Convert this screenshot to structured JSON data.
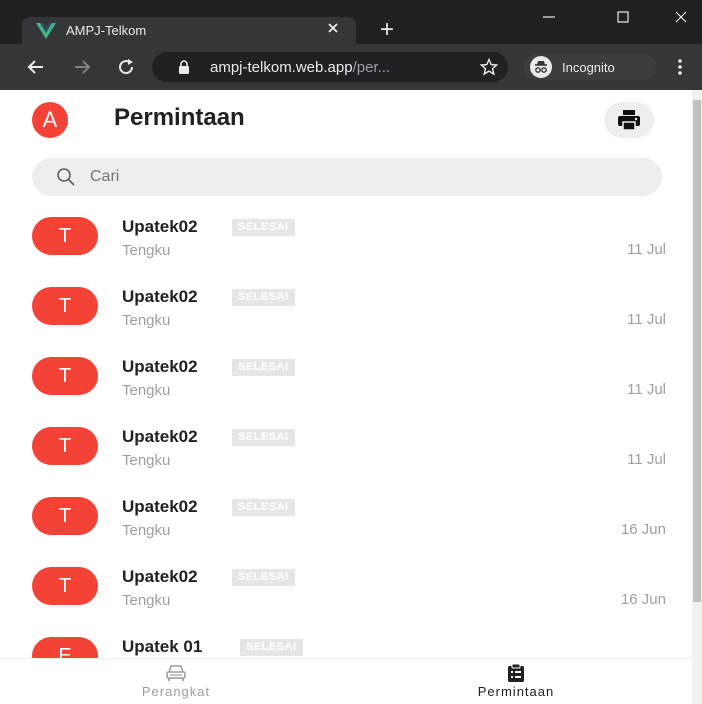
{
  "browser": {
    "tab_title": "AMPJ-Telkom",
    "new_tab": "+",
    "url_host": "ampj-telkom.web.app",
    "url_path": "/per...",
    "incognito_label": "Incognito"
  },
  "header": {
    "avatar_letter": "A",
    "title": "Permintaan"
  },
  "search": {
    "placeholder": "Cari"
  },
  "list": [
    {
      "avatar": "T",
      "title": "Upatek02",
      "badge": "SELESAI",
      "subtitle": "Tengku",
      "date": "11 Jul"
    },
    {
      "avatar": "T",
      "title": "Upatek02",
      "badge": "SELESAI",
      "subtitle": "Tengku",
      "date": "11 Jul"
    },
    {
      "avatar": "T",
      "title": "Upatek02",
      "badge": "SELESAI",
      "subtitle": "Tengku",
      "date": "11 Jul"
    },
    {
      "avatar": "T",
      "title": "Upatek02",
      "badge": "SELESAI",
      "subtitle": "Tengku",
      "date": "11 Jul"
    },
    {
      "avatar": "T",
      "title": "Upatek02",
      "badge": "SELESAI",
      "subtitle": "Tengku",
      "date": "16 Jun"
    },
    {
      "avatar": "T",
      "title": "Upatek02",
      "badge": "SELESAI",
      "subtitle": "Tengku",
      "date": "16 Jun"
    },
    {
      "avatar": "E",
      "title": "Upatek 01",
      "badge": "SELESAI",
      "subtitle": "",
      "date": ""
    }
  ],
  "bottom_nav": {
    "item1_label": "Perangkat",
    "item2_label": "Permintaan"
  },
  "colors": {
    "accent": "#f44336",
    "chrome_dark": "#202124",
    "chrome_toolbar": "#35363a",
    "vue_green": "#41b883"
  },
  "icons": {
    "favicon": "vue-logo-icon",
    "print": "printer-icon",
    "search": "search-icon",
    "nav1": "car-icon",
    "nav2": "clipboard-icon"
  }
}
